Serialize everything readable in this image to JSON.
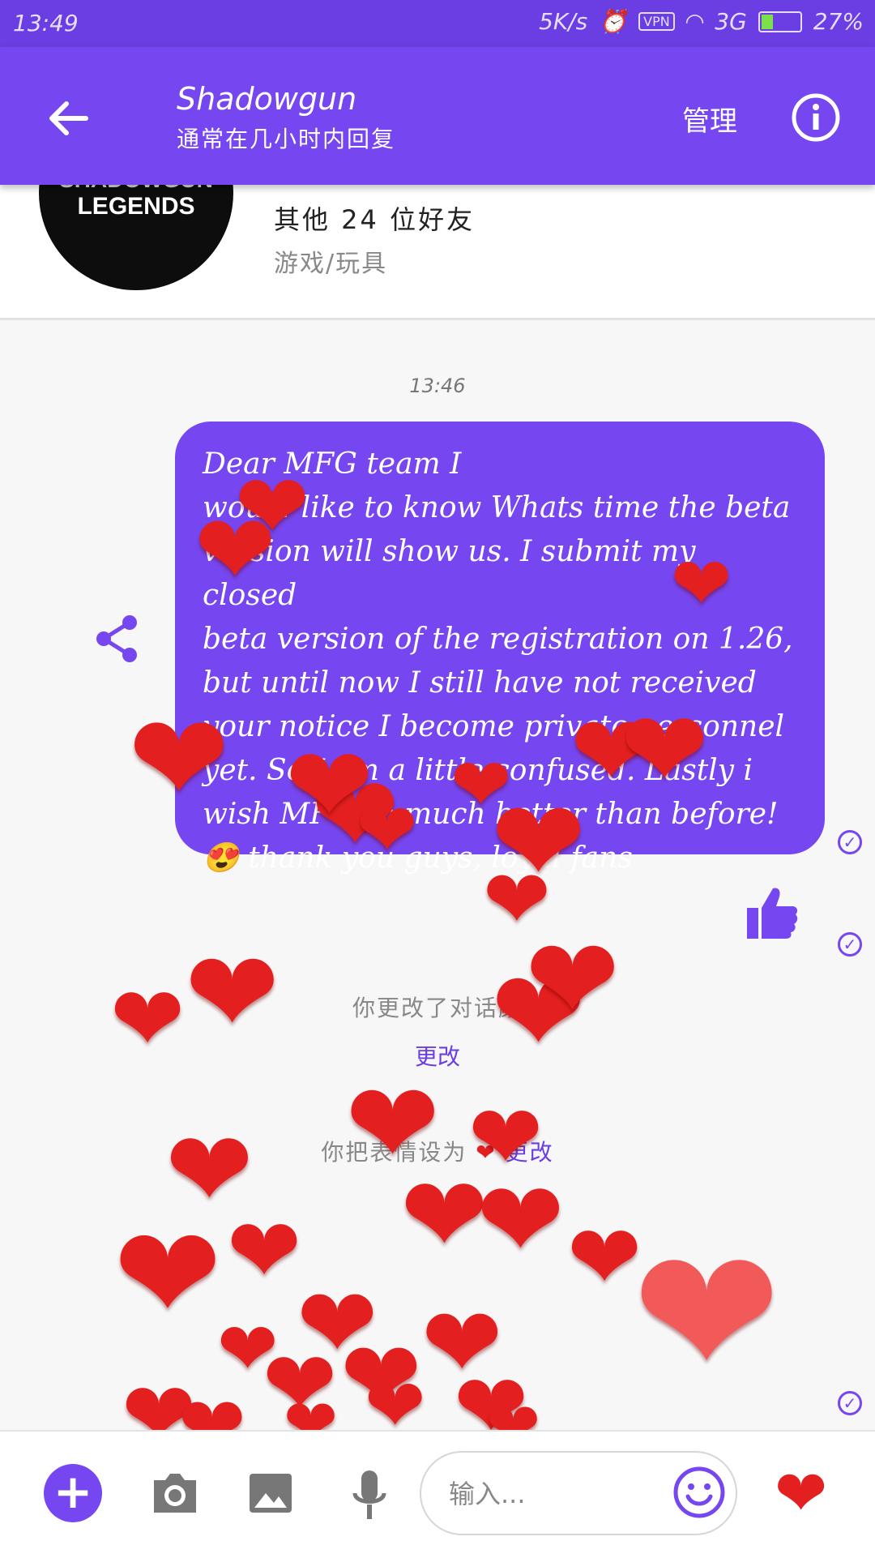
{
  "status_bar": {
    "time": "13:49",
    "speed": "5K/s",
    "vpn": "VPN",
    "network": "3G",
    "battery": "27%"
  },
  "header": {
    "title": "Shadowgun",
    "subtitle": "通常在几小时内回复",
    "manage_label": "管理"
  },
  "profile": {
    "avatar_line1": "SHADOWGUN",
    "avatar_line2": "LEGENDS",
    "friends_text": "其他 24 位好友",
    "category": "游戏/玩具"
  },
  "chat": {
    "timestamp": "13:46",
    "message_lines": [
      "Dear MFG team                              I",
      "would like to know Whats time the beta",
      "version will show us. I submit my closed",
      "beta version of the registration on 1.26,",
      "but until now I still have not received",
      "your notice I become private personnel",
      "yet. So I am a little confused. Lastly i",
      "wish MFG so much better than before!",
      "😍            thank you guys, loyal fans"
    ],
    "system_notice_1": "你更改了对话颜",
    "system_notice_1_action": "更改",
    "system_notice_2": "你把表情设为",
    "system_notice_2_action": "更改"
  },
  "composer": {
    "placeholder": "输入..."
  },
  "icons": [
    "back-arrow-icon",
    "info-icon",
    "share-icon",
    "check-icon",
    "thumbs-up-icon",
    "plus-icon",
    "camera-icon",
    "image-icon",
    "microphone-icon",
    "emoji-icon",
    "heart-icon"
  ],
  "colors": {
    "accent": "#7646f0",
    "heart": "#e41f1f"
  }
}
